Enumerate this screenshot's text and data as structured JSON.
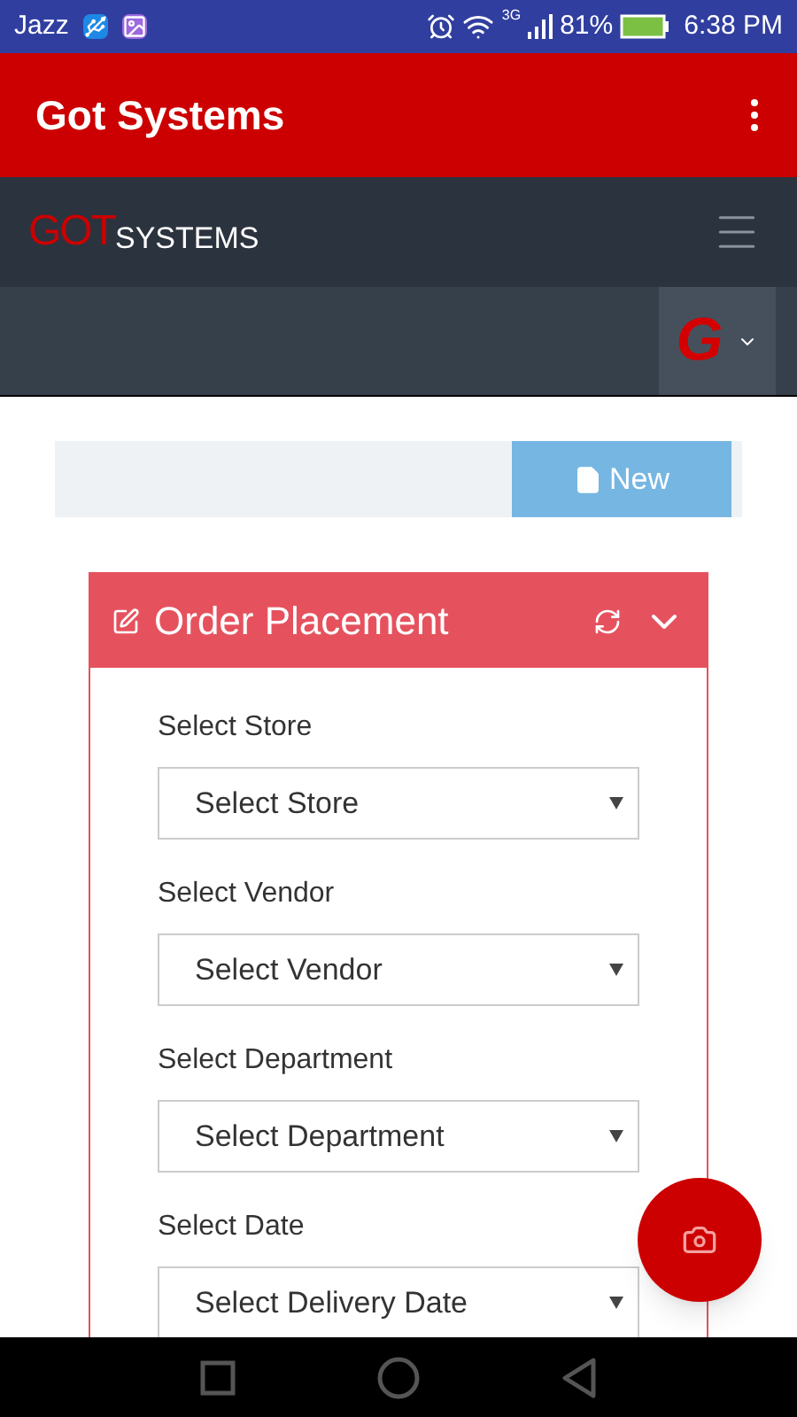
{
  "status_bar": {
    "carrier": "Jazz",
    "network": "3G",
    "battery": "81%",
    "time": "6:38 PM"
  },
  "app_bar": {
    "title": "Got Systems"
  },
  "site_nav": {
    "logo_first": "GOT",
    "logo_second": "SYSTEMS"
  },
  "user_menu": {
    "avatar_letter": "G"
  },
  "toolbar": {
    "new_button": "New"
  },
  "panel": {
    "title": "Order Placement",
    "expanded": true,
    "fields": [
      {
        "label": "Select Store",
        "value": "Select Store"
      },
      {
        "label": "Select Vendor",
        "value": "Select Vendor"
      },
      {
        "label": "Select Department",
        "value": "Select Department"
      },
      {
        "label": "Select Date",
        "value": "Select Delivery Date"
      }
    ]
  }
}
